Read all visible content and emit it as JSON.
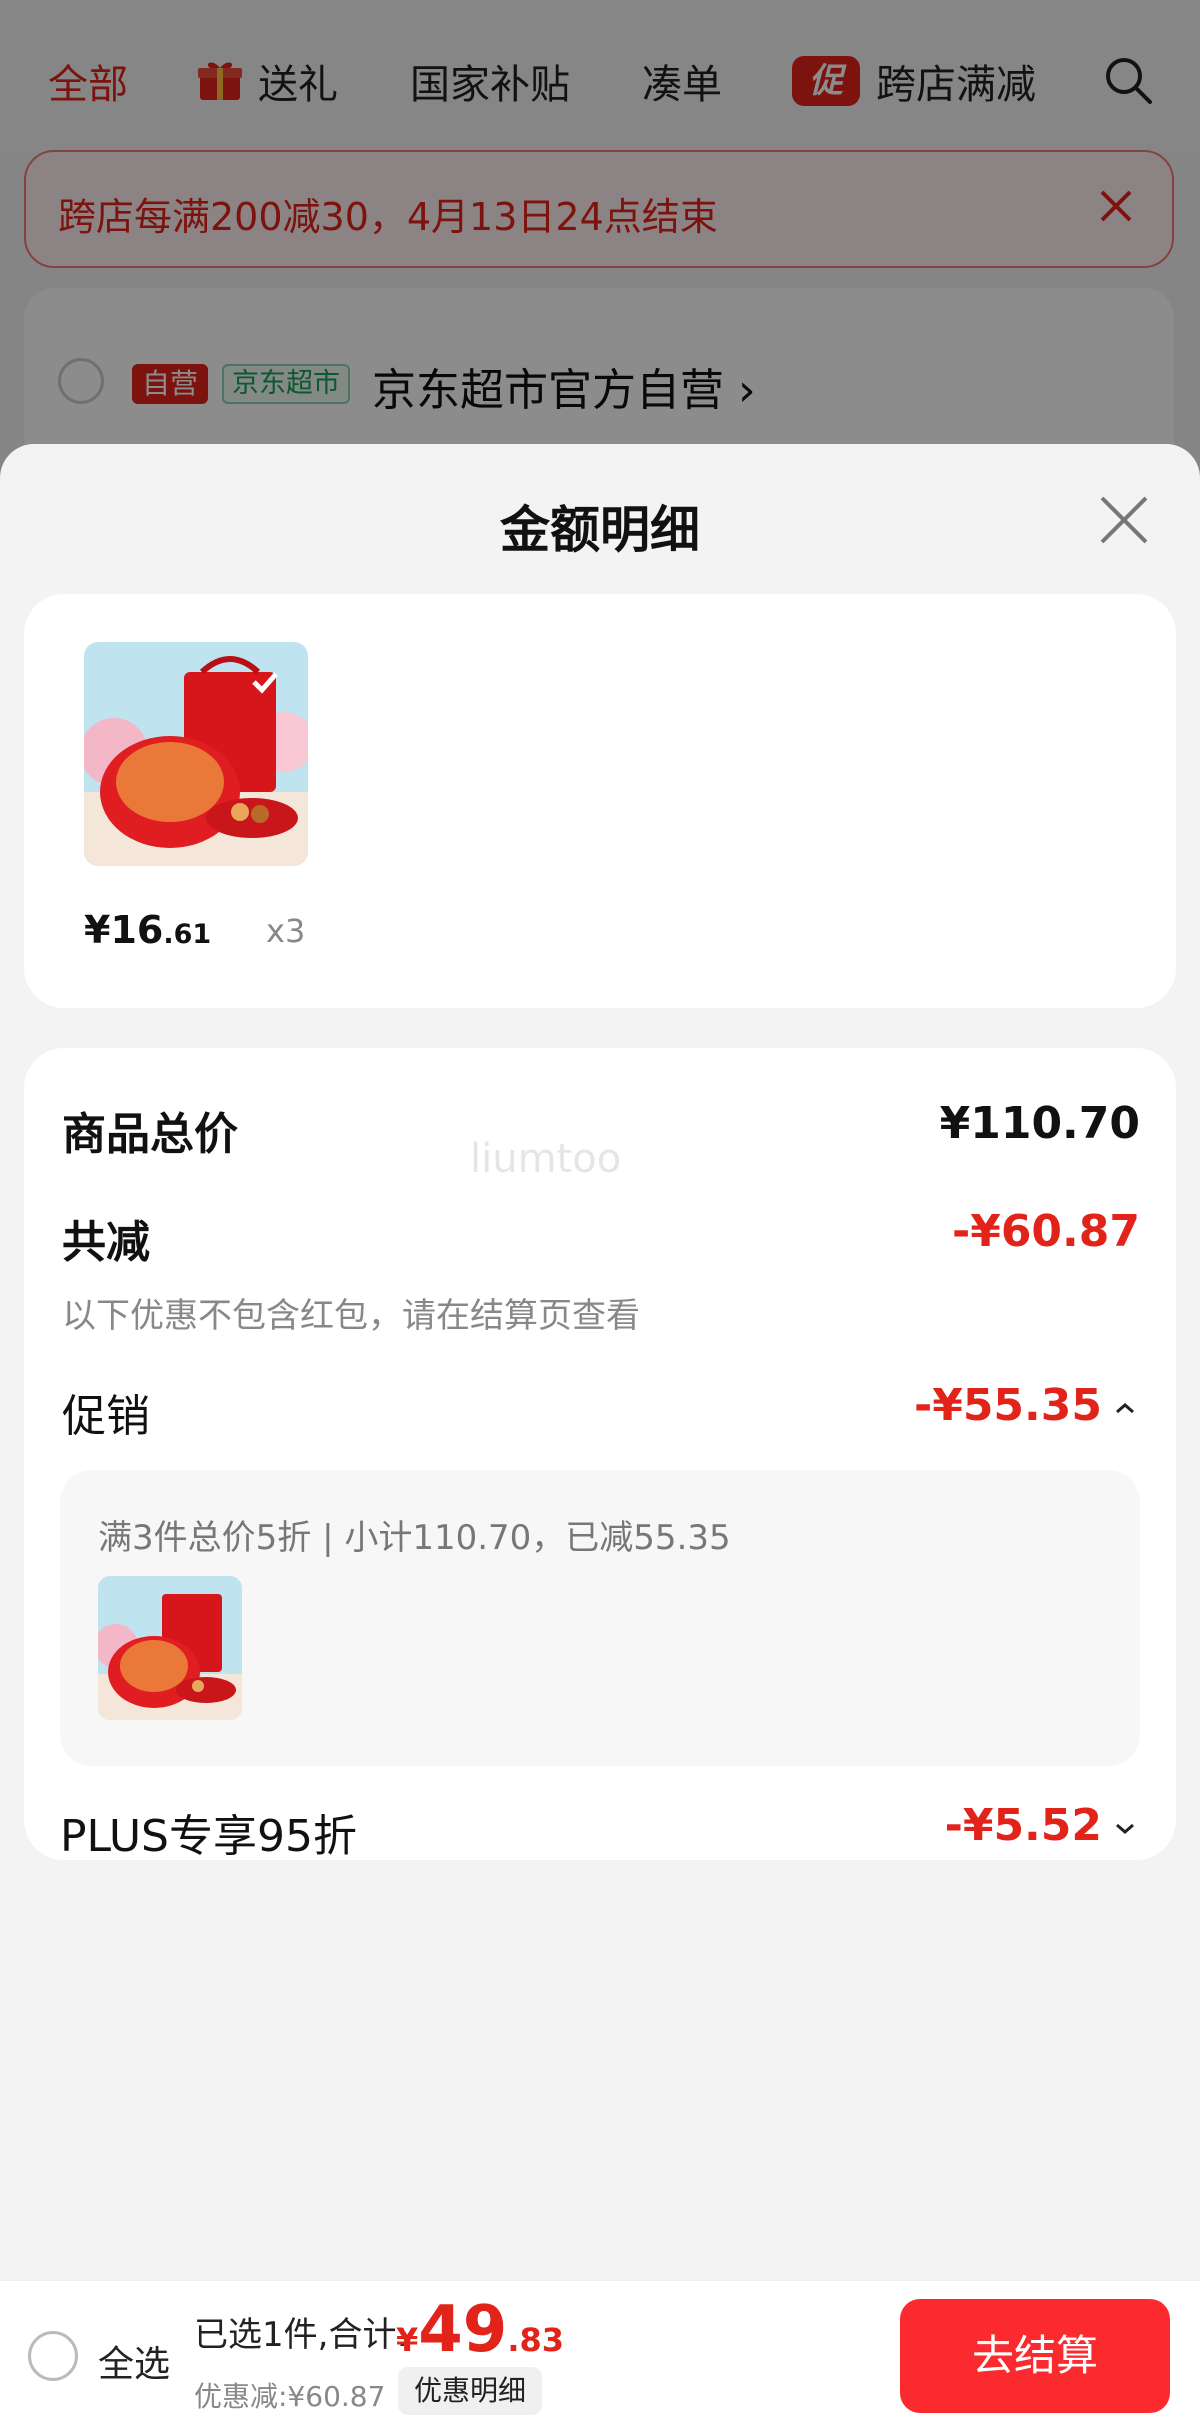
{
  "background": {
    "tabs": [
      {
        "label": "全部",
        "active": true
      },
      {
        "label": "送礼",
        "icon": "gift-icon"
      },
      {
        "label": "国家补贴"
      },
      {
        "label": "凑单"
      },
      {
        "label": "跨店满减",
        "badge": "促"
      }
    ],
    "promo_banner": "跨店每满200减30，4月13日24点结束",
    "store": {
      "tag_self": "自营",
      "tag_market": "京东超市",
      "name": "京东超市官方自营"
    }
  },
  "sheet": {
    "title": "金额明细",
    "product": {
      "price_yen": "¥",
      "price_int": "16",
      "price_dec": ".61",
      "qty": "x3"
    },
    "summary": {
      "total_label": "商品总价",
      "total_value": "¥110.70",
      "reduced_label": "共减",
      "reduced_value": "-¥60.87",
      "note": "以下优惠不包含红包，请在结算页查看",
      "promo_label": "促销",
      "promo_value": "-¥55.35",
      "promo_detail": "满3件总价5折 | 小计110.70，已减55.35",
      "plus_label": "PLUS专享95折",
      "plus_value": "-¥5.52"
    }
  },
  "bottom_bar": {
    "select_all": "全选",
    "selected_text": "已选1件,合计:",
    "total_yen": "¥",
    "total_int": "49",
    "total_dec": ".83",
    "discount_text": "优惠减:¥60.87",
    "detail_button": "优惠明细",
    "checkout_button": "去结算"
  },
  "watermark": "liumtoo",
  "colors": {
    "accent": "#e2231a",
    "checkout": "#fb2a2f"
  }
}
